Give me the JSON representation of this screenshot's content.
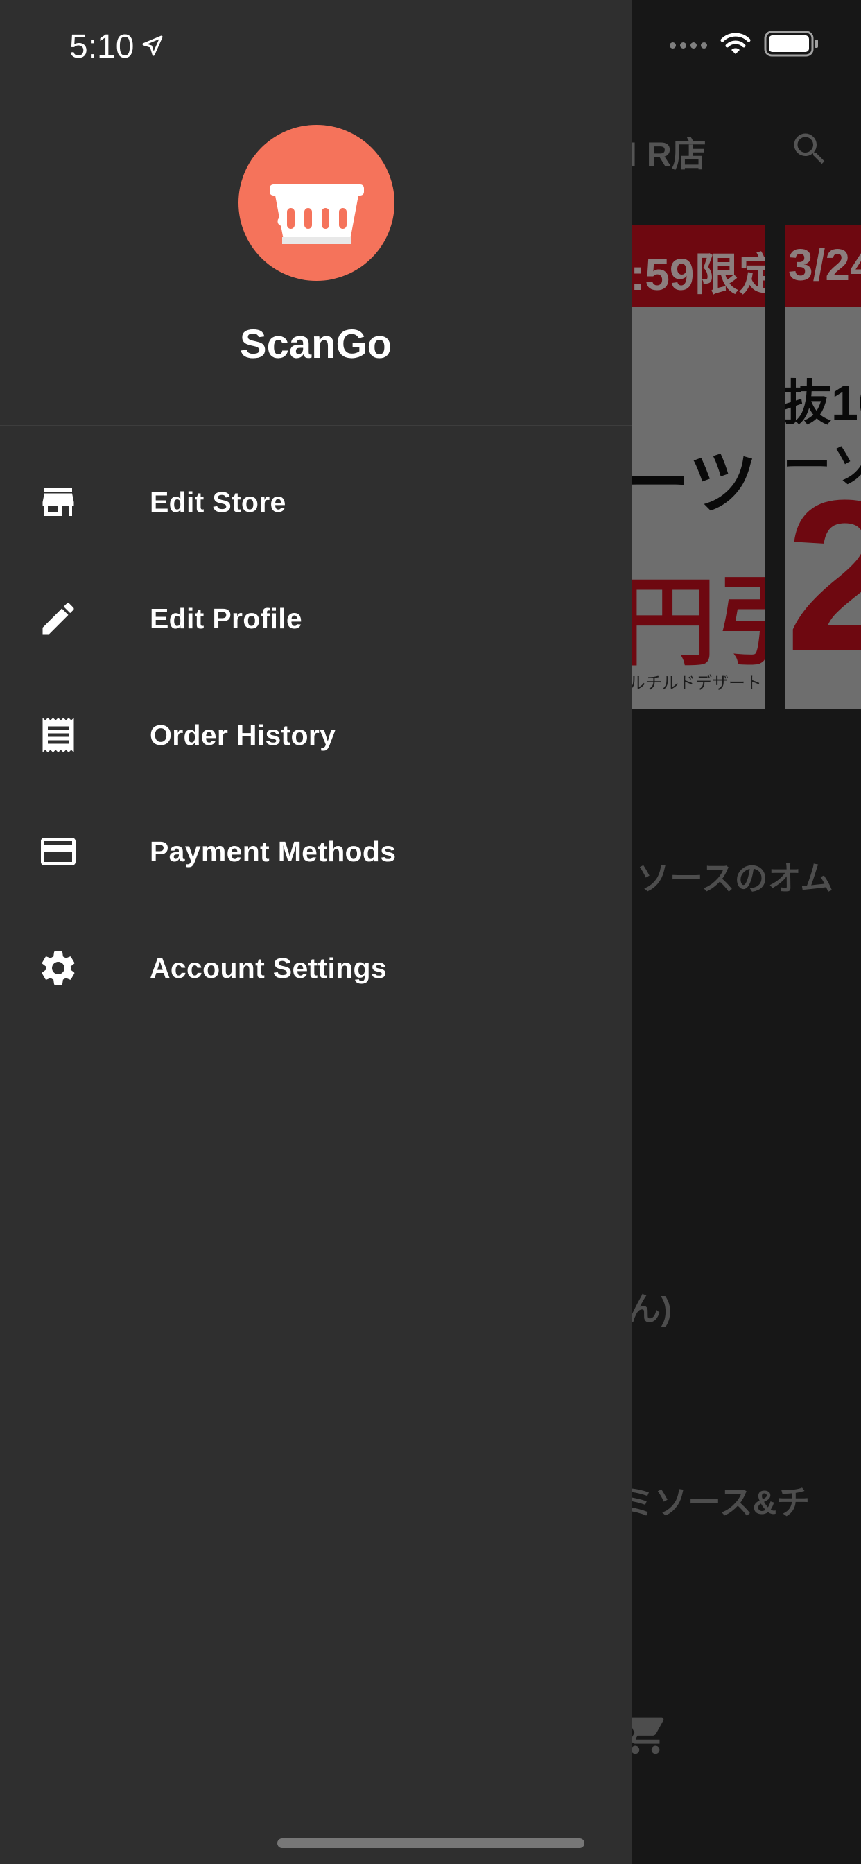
{
  "status_bar": {
    "time": "5:10",
    "location_icon": "location-arrow-icon",
    "signal_icon": "cellular-dots-icon",
    "wifi_icon": "wifi-icon",
    "battery_icon": "battery-icon"
  },
  "drawer": {
    "logo_icon": "shopping-basket-icon",
    "logo_color": "#f5735b",
    "app_name": "ScanGo",
    "menu": [
      {
        "label": "Edit Store",
        "icon": "store-icon"
      },
      {
        "label": "Edit Profile",
        "icon": "pencil-icon"
      },
      {
        "label": "Order History",
        "icon": "receipt-icon"
      },
      {
        "label": "Payment Methods",
        "icon": "credit-card-icon"
      },
      {
        "label": "Account Settings",
        "icon": "gear-icon"
      }
    ]
  },
  "background_app": {
    "header_title": "I R店",
    "search_icon": "search-icon",
    "banners": [
      {
        "top_text": ":59限定",
        "main_text": "ーツ",
        "price_text": "円引",
        "fine_print": "ルチルドデザート"
      },
      {
        "top_text": "3/24",
        "main_text": "抜10",
        "sub_text": "ーソ",
        "big_text": "2"
      }
    ],
    "items": [
      "ソースのオム",
      "ん)",
      "ミソース&チ"
    ],
    "cart_icon": "cart-icon",
    "accent_color": "#c8101e"
  }
}
